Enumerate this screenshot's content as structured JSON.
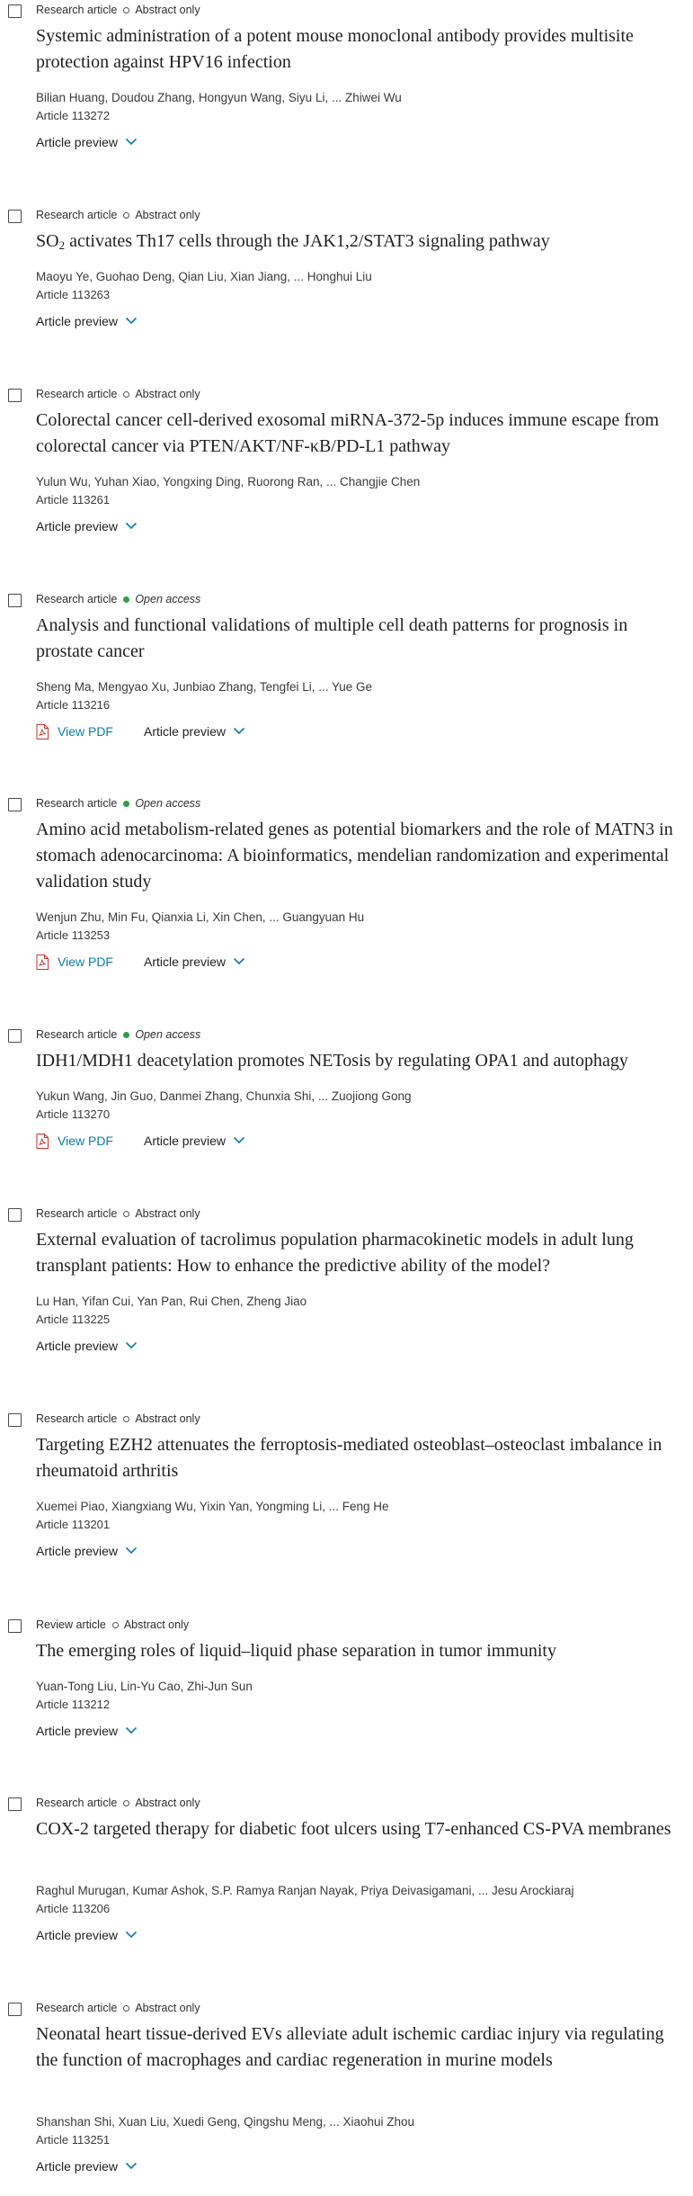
{
  "articles": [
    {
      "type": "Research article",
      "access": "Abstract only",
      "open": false,
      "title": "Systemic administration of a potent mouse monoclonal antibody provides multisite protection against HPV16 infection",
      "authors": "Bilian Huang, Doudou Zhang, Hongyun Wang, Siyu Li, ... Zhiwei Wu",
      "article_number": "Article 113272",
      "has_pdf": false,
      "preview_label": "Article preview"
    },
    {
      "type": "Research article",
      "access": "Abstract only",
      "open": false,
      "title": "SO2 activates Th17 cells through the JAK1,2/STAT3 signaling pathway",
      "title_parts": [
        "SO",
        "2",
        " activates Th17 cells through the JAK1,2/STAT3 signaling pathway"
      ],
      "authors": "Maoyu Ye, Guohao Deng, Qian Liu, Xian Jiang, ... Honghui Liu",
      "article_number": "Article 113263",
      "has_pdf": false,
      "preview_label": "Article preview"
    },
    {
      "type": "Research article",
      "access": "Abstract only",
      "open": false,
      "title": "Colorectal cancer cell-derived exosomal miRNA-372-5p induces immune escape from colorectal cancer via PTEN/AKT/NF-κB/PD-L1 pathway",
      "authors": "Yulun Wu, Yuhan Xiao, Yongxing Ding, Ruorong Ran, ... Changjie Chen",
      "article_number": "Article 113261",
      "has_pdf": false,
      "preview_label": "Article preview"
    },
    {
      "type": "Research article",
      "access": "Open access",
      "open": true,
      "title": "Analysis and functional validations of multiple cell death patterns for prognosis in prostate cancer",
      "authors": "Sheng Ma, Mengyao Xu, Junbiao Zhang, Tengfei Li, ... Yue Ge",
      "article_number": "Article 113216",
      "has_pdf": true,
      "pdf_label": "View PDF",
      "preview_label": "Article preview"
    },
    {
      "type": "Research article",
      "access": "Open access",
      "open": true,
      "title": "Amino acid metabolism-related genes as potential biomarkers and the role of MATN3 in stomach adenocarcinoma: A bioinformatics, mendelian randomization and experimental validation study",
      "authors": "Wenjun Zhu, Min Fu, Qianxia Li, Xin Chen, ... Guangyuan Hu",
      "article_number": "Article 113253",
      "has_pdf": true,
      "pdf_label": "View PDF",
      "preview_label": "Article preview"
    },
    {
      "type": "Research article",
      "access": "Open access",
      "open": true,
      "title": "IDH1/MDH1 deacetylation promotes NETosis by regulating OPA1 and autophagy",
      "authors": "Yukun Wang, Jin Guo, Danmei Zhang, Chunxia Shi, ... Zuojiong Gong",
      "article_number": "Article 113270",
      "has_pdf": true,
      "pdf_label": "View PDF",
      "preview_label": "Article preview"
    },
    {
      "type": "Research article",
      "access": "Abstract only",
      "open": false,
      "title": "External evaluation of tacrolimus population pharmacokinetic models in adult lung transplant patients: How to enhance the predictive ability of the model?",
      "authors": "Lu Han, Yifan Cui, Yan Pan, Rui Chen, Zheng Jiao",
      "article_number": "Article 113225",
      "has_pdf": false,
      "preview_label": "Article preview"
    },
    {
      "type": "Research article",
      "access": "Abstract only",
      "open": false,
      "title": "Targeting EZH2 attenuates the ferroptosis-mediated osteoblast–osteoclast imbalance in rheumatoid arthritis",
      "authors": "Xuemei Piao, Xiangxiang Wu, Yixin Yan, Yongming Li, ... Feng He",
      "article_number": "Article 113201",
      "has_pdf": false,
      "preview_label": "Article preview"
    },
    {
      "type": "Review article",
      "access": "Abstract only",
      "open": false,
      "title": "The emerging roles of liquid–liquid phase separation in tumor immunity",
      "authors": "Yuan-Tong Liu, Lin-Yu Cao, Zhi-Jun Sun",
      "article_number": "Article 113212",
      "has_pdf": false,
      "preview_label": "Article preview"
    },
    {
      "type": "Research article",
      "access": "Abstract only",
      "open": false,
      "title": "COX-2 targeted therapy for diabetic foot ulcers using T7-enhanced CS-PVA membranes",
      "authors": "Raghul Murugan, Kumar Ashok, S.P. Ramya Ranjan Nayak, Priya Deivasigamani, ... Jesu Arockiaraj",
      "article_number": "Article 113206",
      "has_pdf": false,
      "preview_label": "Article preview"
    },
    {
      "type": "Research article",
      "access": "Abstract only",
      "open": false,
      "title": "Neonatal heart tissue-derived EVs alleviate adult ischemic cardiac injury via regulating the function of macrophages and cardiac regeneration in murine models",
      "authors": "Shanshan Shi, Xuan Liu, Xuedi Geng, Qingshu Meng, ... Xiaohui Zhou",
      "article_number": "Article 113251",
      "has_pdf": false,
      "preview_label": "Article preview"
    }
  ]
}
